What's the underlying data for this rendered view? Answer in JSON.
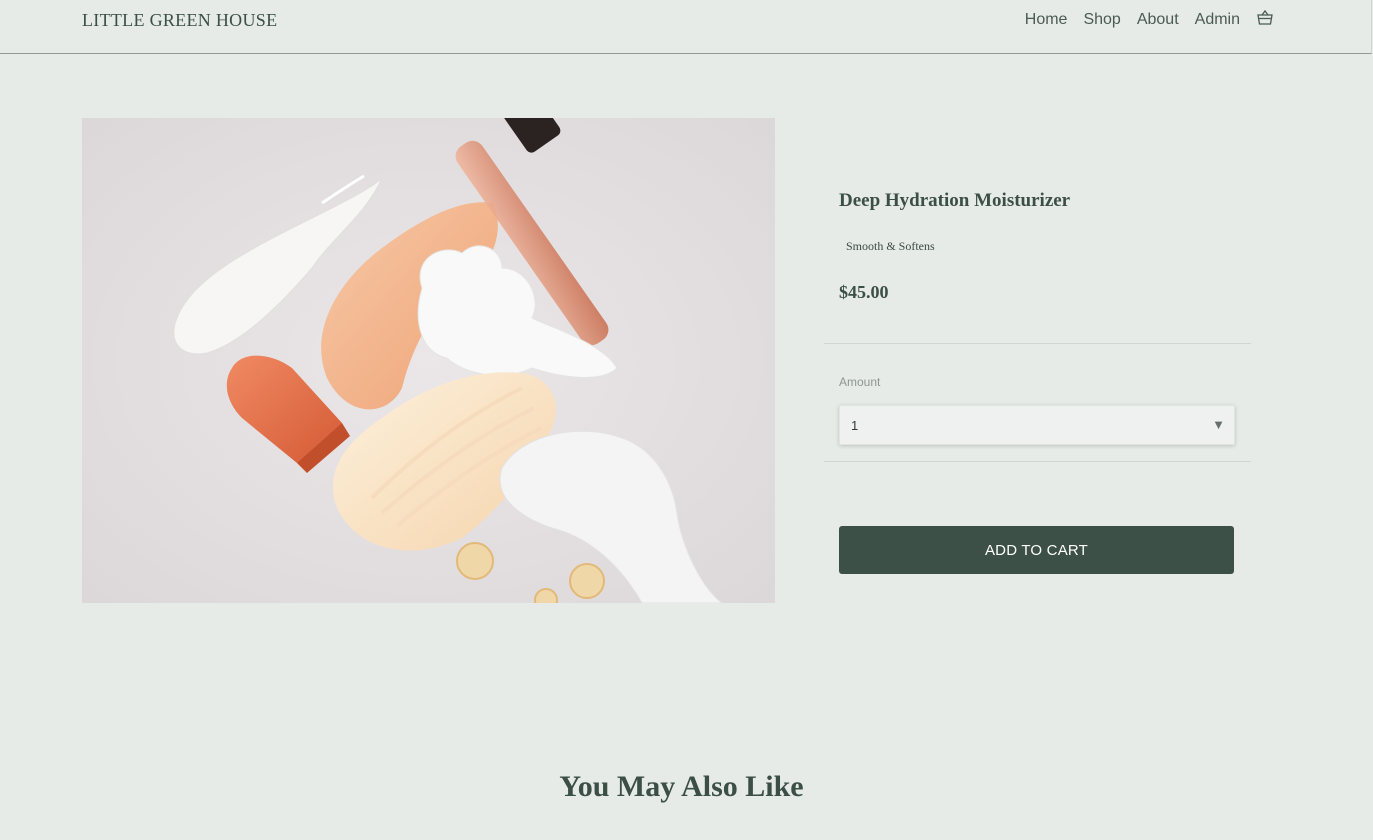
{
  "header": {
    "brand": "LITTLE GREEN HOUSE",
    "nav": [
      {
        "label": "Home"
      },
      {
        "label": "Shop"
      },
      {
        "label": "About"
      },
      {
        "label": "Admin"
      }
    ],
    "cart_icon": "basket-icon"
  },
  "product": {
    "image_alt": "cosmetics-swatches-photo",
    "title": "Deep Hydration Moisturizer",
    "tagline": "Smooth & Softens",
    "price": "$45.00",
    "amount": {
      "label": "Amount",
      "selected": "1"
    },
    "add_to_cart_label": "ADD TO CART"
  },
  "related": {
    "heading": "You May Also Like"
  },
  "colors": {
    "background": "#e7ebe8",
    "brand_green": "#3c5047",
    "text": "#3b4f45"
  }
}
